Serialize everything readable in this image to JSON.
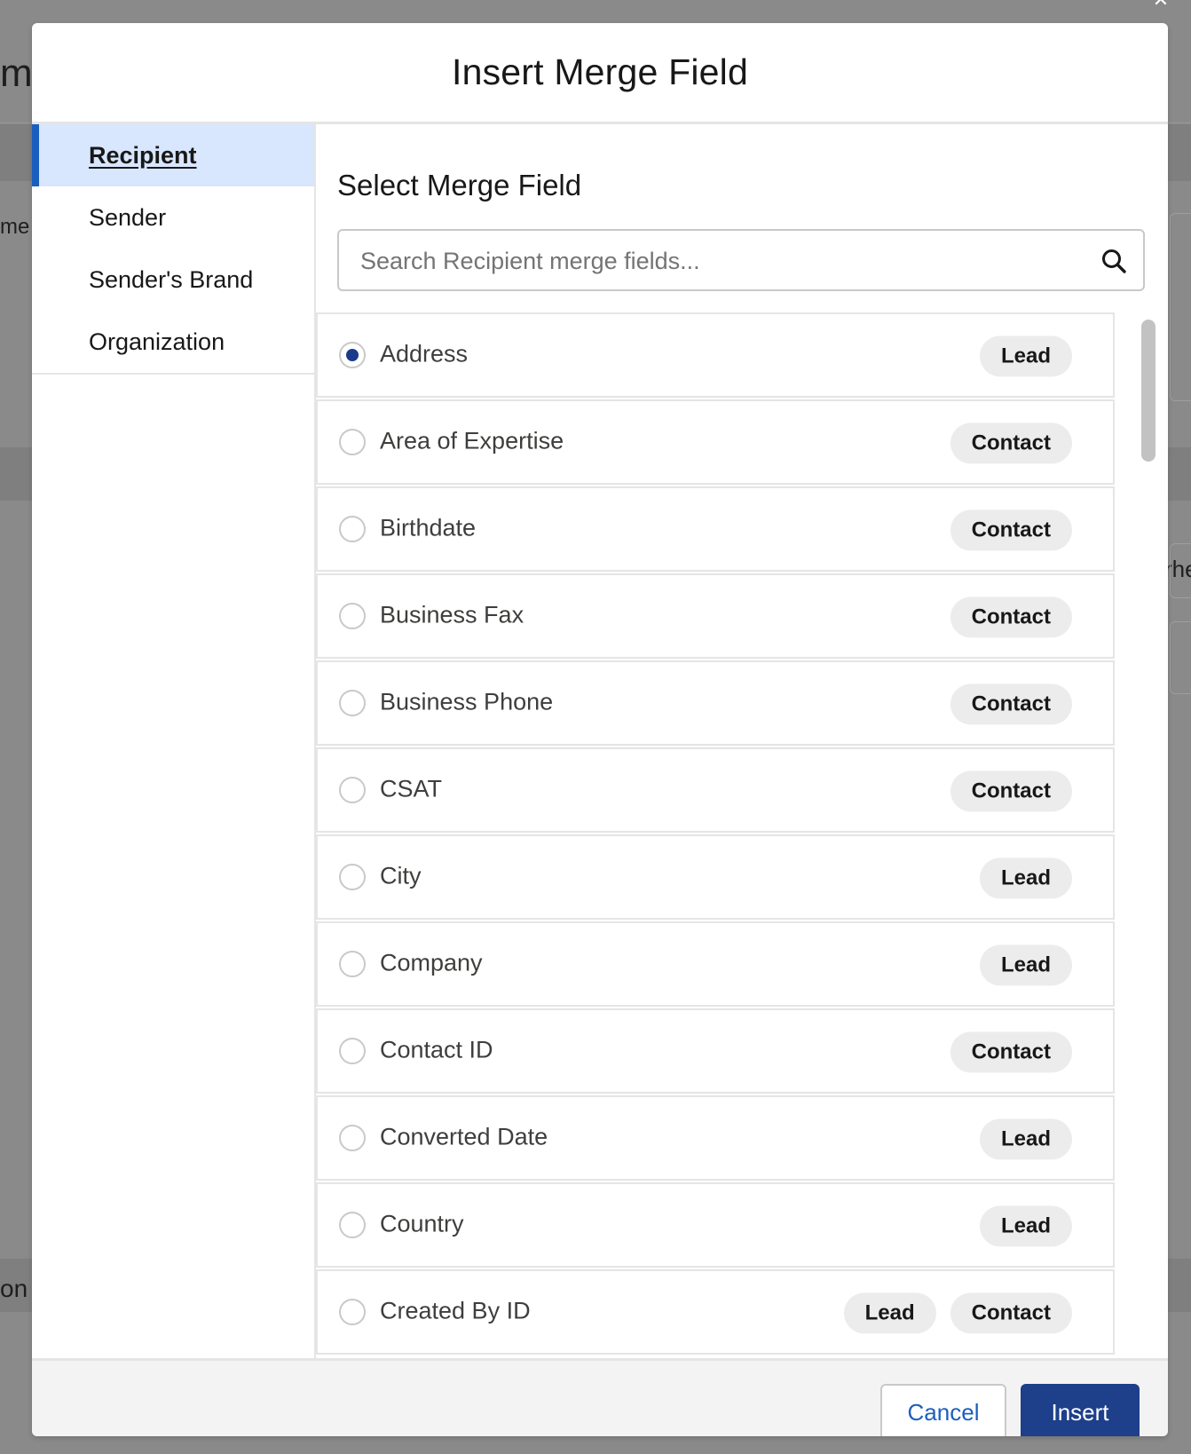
{
  "background": {
    "fragments": [
      "mp",
      "me",
      "rhe",
      "on"
    ]
  },
  "modal": {
    "title": "Insert Merge Field"
  },
  "nav": {
    "items": [
      {
        "label": "Recipient",
        "active": true
      },
      {
        "label": "Sender",
        "active": false
      },
      {
        "label": "Sender's Brand",
        "active": false
      },
      {
        "label": "Organization",
        "active": false
      }
    ]
  },
  "main": {
    "section_title": "Select Merge Field",
    "search": {
      "placeholder": "Search Recipient merge fields...",
      "value": ""
    },
    "fields": [
      {
        "label": "Address",
        "selected": true,
        "badges": [
          "Lead"
        ]
      },
      {
        "label": "Area of Expertise",
        "selected": false,
        "badges": [
          "Contact"
        ]
      },
      {
        "label": "Birthdate",
        "selected": false,
        "badges": [
          "Contact"
        ]
      },
      {
        "label": "Business Fax",
        "selected": false,
        "badges": [
          "Contact"
        ]
      },
      {
        "label": "Business Phone",
        "selected": false,
        "badges": [
          "Contact"
        ]
      },
      {
        "label": "CSAT",
        "selected": false,
        "badges": [
          "Contact"
        ]
      },
      {
        "label": "City",
        "selected": false,
        "badges": [
          "Lead"
        ]
      },
      {
        "label": "Company",
        "selected": false,
        "badges": [
          "Lead"
        ]
      },
      {
        "label": "Contact ID",
        "selected": false,
        "badges": [
          "Contact"
        ]
      },
      {
        "label": "Converted Date",
        "selected": false,
        "badges": [
          "Lead"
        ]
      },
      {
        "label": "Country",
        "selected": false,
        "badges": [
          "Lead"
        ]
      },
      {
        "label": "Created By ID",
        "selected": false,
        "badges": [
          "Lead",
          "Contact"
        ]
      }
    ]
  },
  "footer": {
    "cancel_label": "Cancel",
    "insert_label": "Insert"
  },
  "colors": {
    "accent": "#1b5fbe",
    "active_nav_bg": "#d8e6fe",
    "primary_button": "#1e3f8a",
    "radio_checked": "#1b3a8a"
  }
}
